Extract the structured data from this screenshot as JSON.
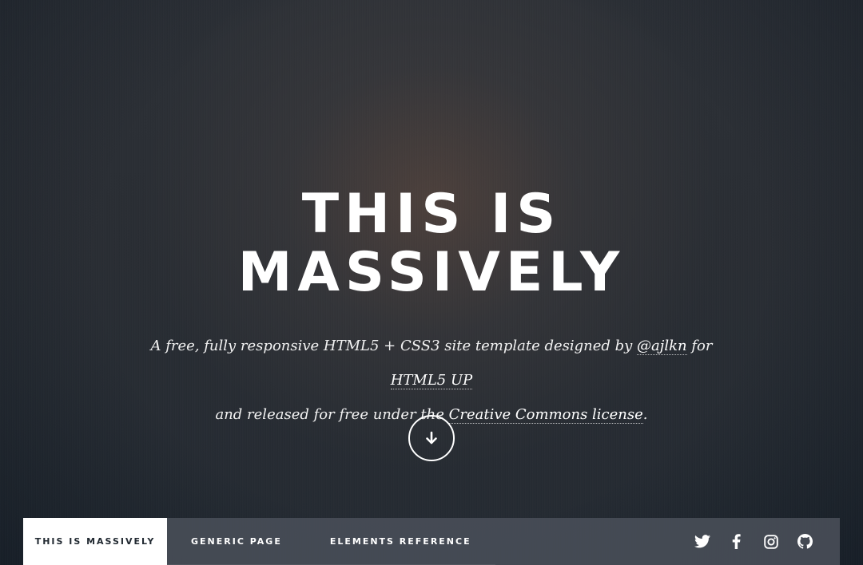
{
  "intro": {
    "title_line1": "THIS IS",
    "title_line2": "MASSIVELY",
    "desc_part1": "A free, fully responsive HTML5 + CSS3 site template designed by ",
    "desc_link1": "@ajlkn",
    "desc_part2": " for ",
    "desc_link2": "HTML5 UP",
    "desc_part3": " and released for free under the ",
    "desc_link3": "Creative Commons license",
    "desc_part4": "."
  },
  "scroll_button": {
    "icon": "arrow-down-icon"
  },
  "nav": {
    "items": [
      {
        "label": "THIS IS MASSIVELY",
        "active": true
      },
      {
        "label": "GENERIC PAGE",
        "active": false
      },
      {
        "label": "ELEMENTS REFERENCE",
        "active": false
      }
    ],
    "social_icons": [
      "twitter-icon",
      "facebook-icon",
      "instagram-icon",
      "github-icon"
    ]
  },
  "colors": {
    "text": "#ffffff",
    "nav_background": "#484d57",
    "active_tab_background": "#ffffff",
    "active_tab_text": "#212931"
  }
}
